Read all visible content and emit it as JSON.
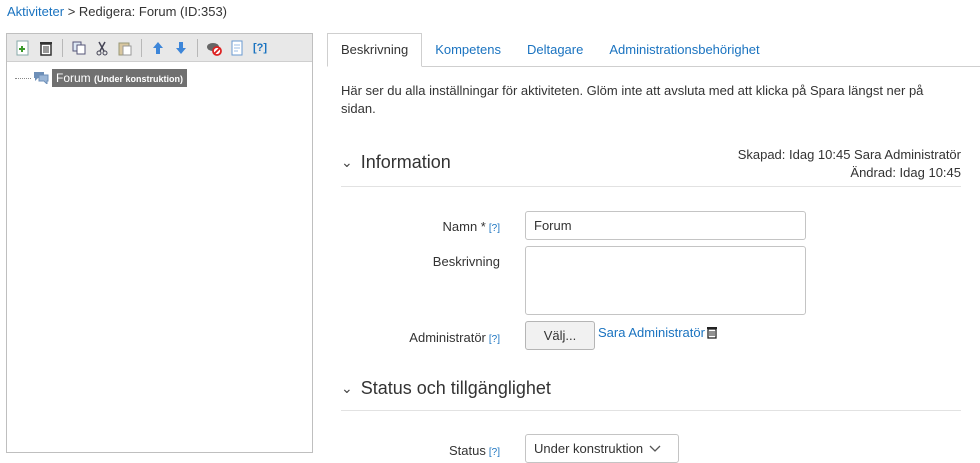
{
  "breadcrumb": {
    "link": "Aktiviteter",
    "separator": " > ",
    "current": "Redigera: Forum (ID:353)"
  },
  "toolbar": {
    "help_label": "[?]",
    "icons": [
      "add-child-icon",
      "delete-icon",
      "copy-icon",
      "cut-icon",
      "paste-icon",
      "move-up-icon",
      "move-down-icon",
      "hide-icon",
      "page-icon",
      "help-icon"
    ]
  },
  "tree": {
    "node_name": "Forum",
    "node_status": "(Under konstruktion)"
  },
  "tabs": [
    "Beskrivning",
    "Kompetens",
    "Deltagare",
    "Administrationsbehörighet"
  ],
  "intro": "Här ser du alla inställningar för aktiviteten. Glöm inte att avsluta med att klicka på Spara längst ner på sidan.",
  "information": {
    "title": "Information",
    "created": "Skapad: Idag 10:45 Sara Administratör",
    "changed": "Ändrad: Idag 10:45"
  },
  "form": {
    "name_label": "Namn *",
    "name_value": "Forum",
    "description_label": "Beskrivning",
    "description_value": "",
    "admin_label": "Administratör",
    "admin_button": "Välj...",
    "admin_name": "Sara Administratör",
    "help": "[?]"
  },
  "status_section": {
    "title": "Status och tillgänglighet",
    "status_label": "Status",
    "status_value": "Under konstruktion"
  },
  "colors": {
    "link": "#1a73c0",
    "selected_node": "#707070",
    "toolbar": "#e8e8e8"
  }
}
